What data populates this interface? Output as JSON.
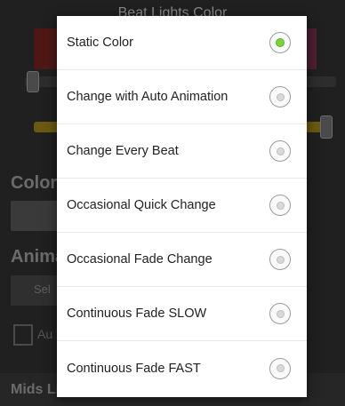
{
  "background": {
    "title": "Beat Lights Color",
    "color_section_label": "Color",
    "animation_section_label": "Animation",
    "select_button_label": "Sel",
    "auto_checkbox_label": "Au",
    "mids_lights_label": "Mids Lights"
  },
  "dialog": {
    "options": [
      {
        "label": "Static Color",
        "selected": true
      },
      {
        "label": "Change with Auto Animation",
        "selected": false
      },
      {
        "label": "Change Every Beat",
        "selected": false
      },
      {
        "label": "Occasional Quick Change",
        "selected": false
      },
      {
        "label": "Occasional Fade Change",
        "selected": false
      },
      {
        "label": "Continuous Fade SLOW",
        "selected": false
      },
      {
        "label": "Continuous Fade FAST",
        "selected": false
      }
    ]
  },
  "colors": {
    "selected_radio": "#7bd23b",
    "dialog_background": "#ffffff",
    "app_background": "#202020"
  }
}
